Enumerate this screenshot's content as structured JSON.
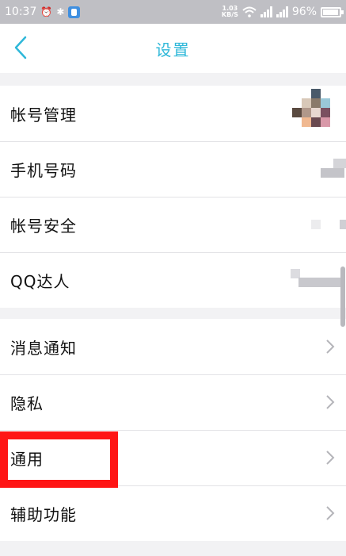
{
  "status_bar": {
    "time": "10:37",
    "net_speed_value": "1.03",
    "net_speed_unit": "KB/S",
    "battery": "96%"
  },
  "header": {
    "title": "设置"
  },
  "account_group": {
    "items": [
      {
        "label": "帐号管理"
      },
      {
        "label": "手机号码"
      },
      {
        "label": "帐号安全"
      },
      {
        "label": "QQ达人"
      }
    ]
  },
  "settings_group": {
    "items": [
      {
        "label": "消息通知"
      },
      {
        "label": "隐私"
      },
      {
        "label": "通用"
      },
      {
        "label": "辅助功能"
      }
    ]
  },
  "colors": {
    "accent": "#2fb8d9",
    "highlight": "#ff1515",
    "status_bar_bg": "#bfbfc4",
    "page_bg": "#f2f2f4"
  },
  "icons": {
    "back": "chevron-left-icon",
    "row_arrow": "chevron-right-icon"
  }
}
